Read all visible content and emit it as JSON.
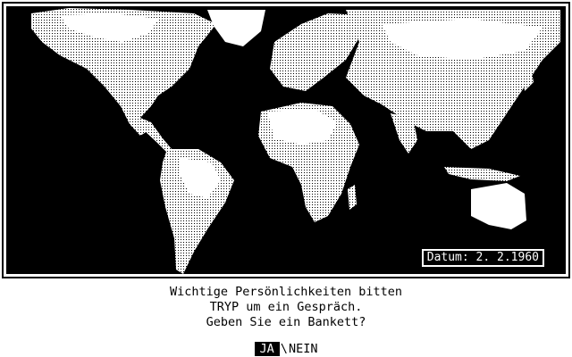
{
  "map": {
    "date_label": "Datum:",
    "date_value": " 2. 2.1960"
  },
  "dialog": {
    "lines": [
      "Wichtige Persönlichkeiten bitten",
      "TRYP um ein Gespräch.",
      "Geben Sie ein Bankett?"
    ],
    "yes_label": "JA",
    "separator": "\\",
    "no_label": "NEIN"
  },
  "colors": {
    "background": "#ffffff",
    "ocean": "#000000",
    "land": "#ffffff"
  }
}
